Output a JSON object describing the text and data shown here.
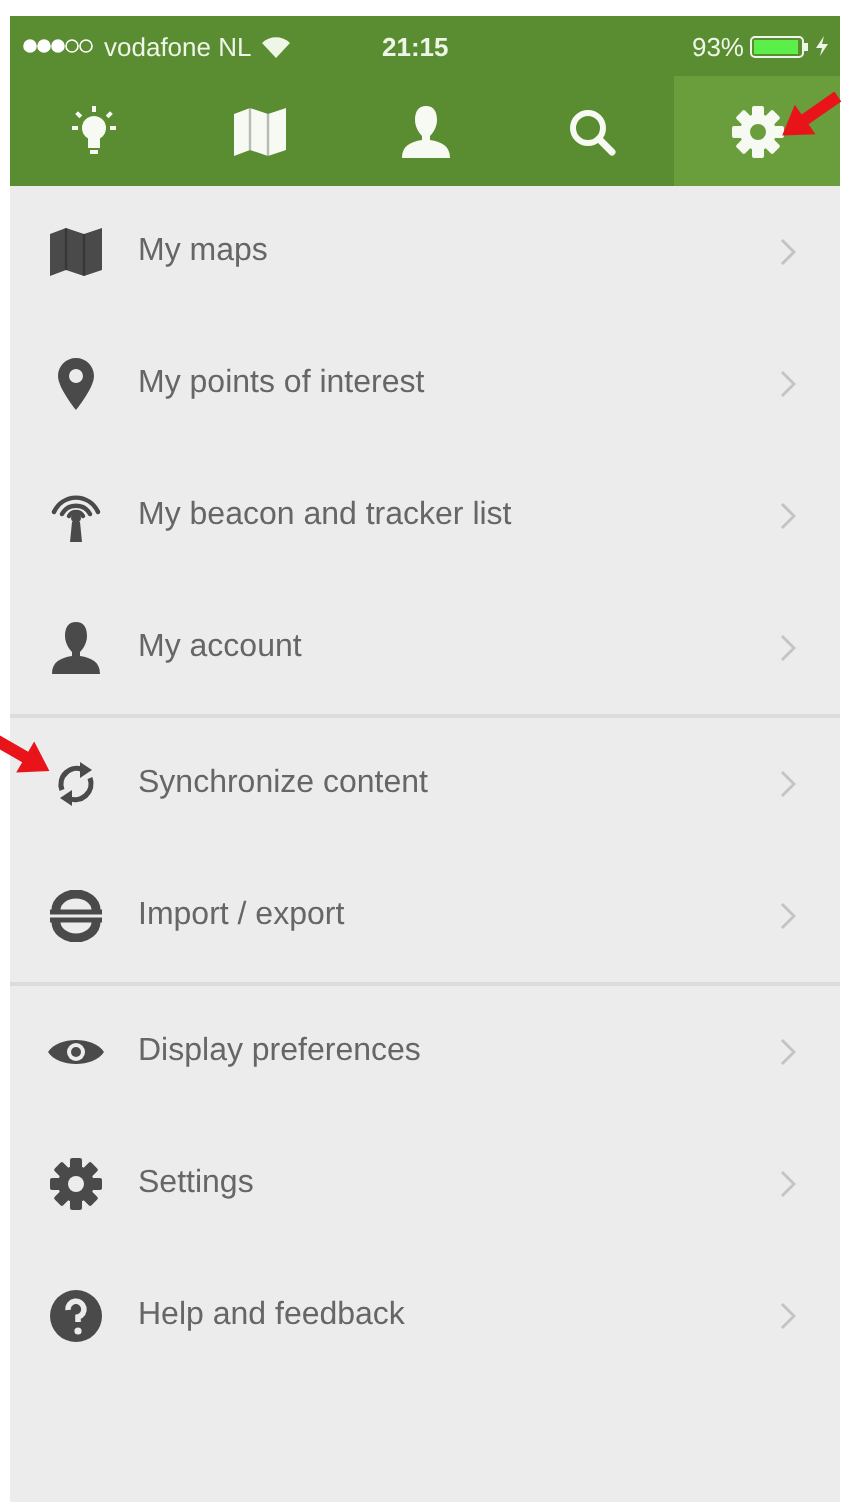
{
  "status_bar": {
    "carrier": "vodafone NL",
    "time": "21:15",
    "battery": "93%",
    "charging": true
  },
  "tabs": [
    {
      "kind": "bulb",
      "selected": false
    },
    {
      "kind": "map",
      "selected": false
    },
    {
      "kind": "person",
      "selected": false
    },
    {
      "kind": "search",
      "selected": false
    },
    {
      "kind": "gear",
      "selected": true
    }
  ],
  "groups": [
    {
      "items": [
        {
          "kind": "map",
          "label": "My maps"
        },
        {
          "kind": "pin",
          "label": "My points of interest"
        },
        {
          "kind": "beacon",
          "label": "My beacon and tracker list"
        },
        {
          "kind": "person",
          "label": "My account"
        }
      ]
    },
    {
      "items": [
        {
          "kind": "sync",
          "label": "Synchronize content"
        },
        {
          "kind": "swap",
          "label": "Import / export"
        }
      ]
    },
    {
      "items": [
        {
          "kind": "eye",
          "label": "Display preferences"
        },
        {
          "kind": "gear",
          "label": "Settings"
        },
        {
          "kind": "help",
          "label": "Help and feedback"
        }
      ]
    }
  ],
  "annotations": [
    {
      "kind": "arrow"
    },
    {
      "kind": "arrow"
    }
  ]
}
